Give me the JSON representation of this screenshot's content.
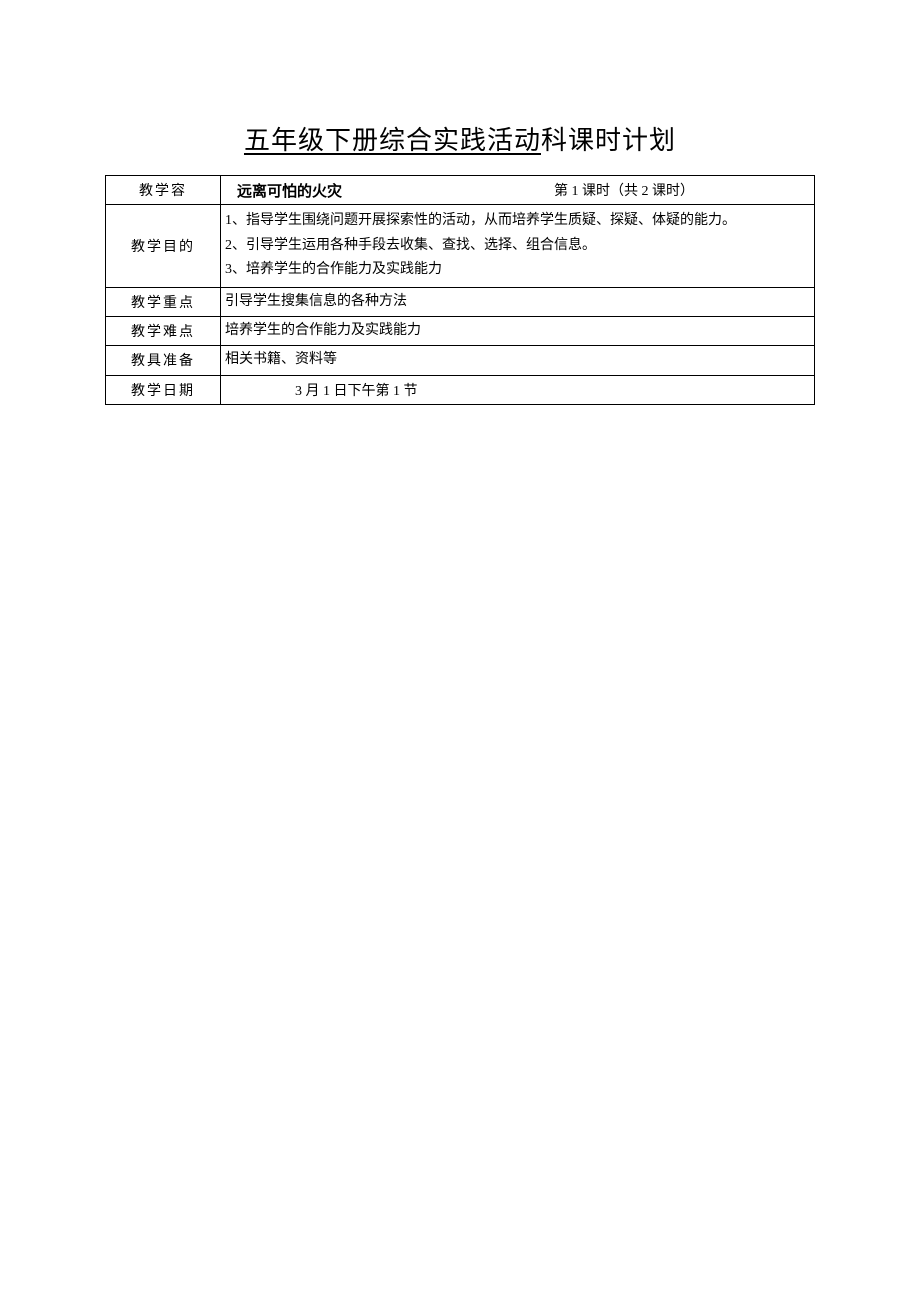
{
  "title_underlined": "五年级下册综合实践活动",
  "title_rest": "科课时计划",
  "rows": {
    "content_label": "教学容",
    "topic_name": "远离可怕的火灾",
    "lesson_info": "第 1 课时（共 2 课时）",
    "objective_label": "教学目的",
    "objective_1": "1、指导学生围绕问题开展探索性的活动，从而培养学生质疑、探疑、体疑的能力。",
    "objective_2": "2、引导学生运用各种手段去收集、查找、选择、组合信息。",
    "objective_3": "3、培养学生的合作能力及实践能力",
    "focus_label": "教学重点",
    "focus_value": "引导学生搜集信息的各种方法",
    "difficulty_label": "教学难点",
    "difficulty_value": "培养学生的合作能力及实践能力",
    "materials_label": "教具准备",
    "materials_value": "相关书籍、资料等",
    "date_label": "教学日期",
    "date_value": "3 月 1 日下午第 1 节"
  }
}
